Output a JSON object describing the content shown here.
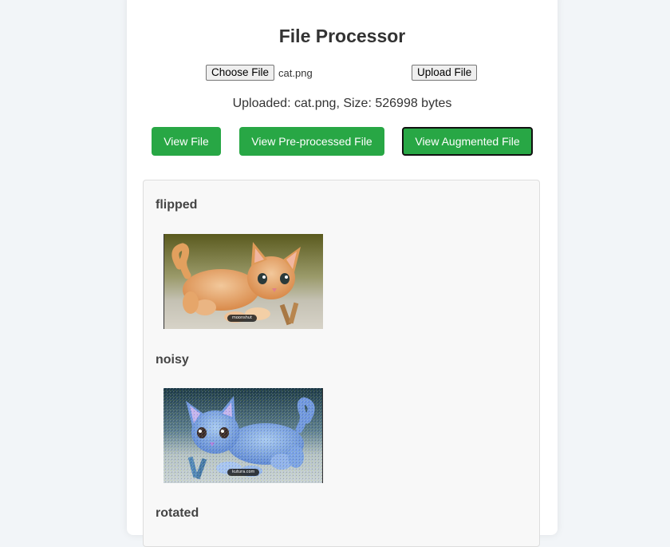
{
  "page": {
    "title": "File Processor"
  },
  "upload": {
    "choose_label": "Choose File",
    "selected_file": "cat.png",
    "upload_label": "Upload File"
  },
  "status": {
    "text": "Uploaded: cat.png, Size: 526998 bytes"
  },
  "actions": {
    "view_file": "View File",
    "view_preprocessed": "View Pre-processed File",
    "view_augmented": "View Augmented File",
    "active": "view_augmented"
  },
  "colors": {
    "accent_green": "#28a745",
    "page_bg": "#f2f5f8",
    "panel_bg": "#f8f8f8"
  },
  "augmentations": [
    {
      "label": "flipped",
      "image": "orange-kitten-photo",
      "watermark": "moonshut"
    },
    {
      "label": "noisy",
      "image": "blue-tinted-kitten-photo",
      "watermark": "kutura.com"
    },
    {
      "label": "rotated",
      "image": "",
      "watermark": ""
    }
  ]
}
